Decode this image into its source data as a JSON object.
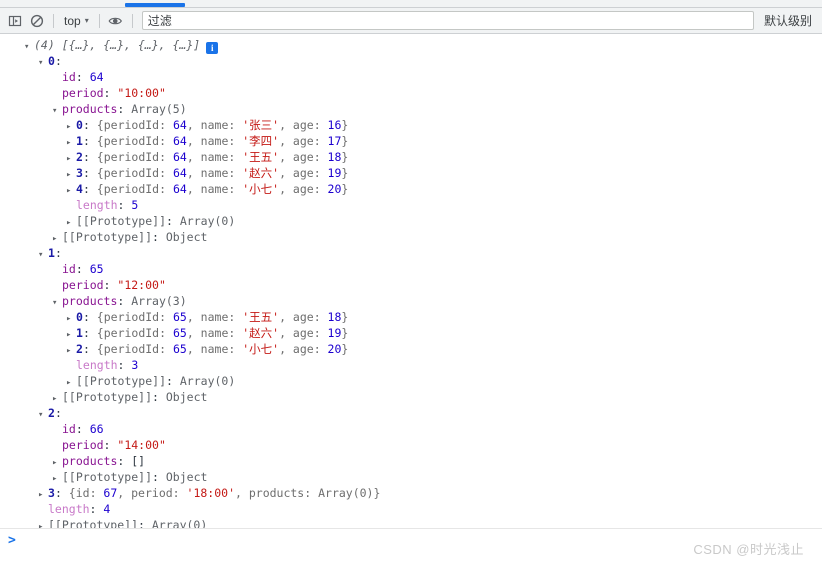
{
  "toolbar": {
    "sidebar_toggle_title": "Show console sidebar",
    "clear_title": "Clear console",
    "context_label": "top",
    "context_caret": "▾",
    "eye_title": "Create live expression",
    "filter_placeholder": "过滤",
    "filter_value": "",
    "levels_label": "默认级别",
    "accent_color": "#1a73e8"
  },
  "console": {
    "root": {
      "triangle": "▾",
      "count": "(4)",
      "preview": "[{…}, {…}, {…}, {…}]",
      "info_badge": "i"
    },
    "rows": [
      {
        "indent": 1,
        "tri": "open",
        "key": "0",
        "keytype": "index",
        "sep": ":",
        "value": "",
        "valtype": "plain"
      },
      {
        "indent": 2,
        "tri": "none",
        "key": "id",
        "keytype": "prop",
        "sep": ": ",
        "value": "64",
        "valtype": "num"
      },
      {
        "indent": 2,
        "tri": "none",
        "key": "period",
        "keytype": "prop",
        "sep": ": ",
        "value": "\"10:00\"",
        "valtype": "str"
      },
      {
        "indent": 2,
        "tri": "open",
        "key": "products",
        "keytype": "prop",
        "sep": ": ",
        "value": "Array(5)",
        "valtype": "dim"
      },
      {
        "indent": 3,
        "tri": "closed",
        "key": "0",
        "keytype": "index",
        "sep": ": ",
        "valtype": "objpreview",
        "obj": {
          "periodId": "64",
          "name": "'张三'",
          "age": "16"
        }
      },
      {
        "indent": 3,
        "tri": "closed",
        "key": "1",
        "keytype": "index",
        "sep": ": ",
        "valtype": "objpreview",
        "obj": {
          "periodId": "64",
          "name": "'李四'",
          "age": "17"
        }
      },
      {
        "indent": 3,
        "tri": "closed",
        "key": "2",
        "keytype": "index",
        "sep": ": ",
        "valtype": "objpreview",
        "obj": {
          "periodId": "64",
          "name": "'王五'",
          "age": "18"
        }
      },
      {
        "indent": 3,
        "tri": "closed",
        "key": "3",
        "keytype": "index",
        "sep": ": ",
        "valtype": "objpreview",
        "obj": {
          "periodId": "64",
          "name": "'赵六'",
          "age": "19"
        }
      },
      {
        "indent": 3,
        "tri": "closed",
        "key": "4",
        "keytype": "index",
        "sep": ": ",
        "valtype": "objpreview",
        "obj": {
          "periodId": "64",
          "name": "'小七'",
          "age": "20"
        }
      },
      {
        "indent": 3,
        "tri": "none",
        "key": "length",
        "keytype": "len",
        "sep": ": ",
        "value": "5",
        "valtype": "num"
      },
      {
        "indent": 3,
        "tri": "closed",
        "key": "[[Prototype]]",
        "keytype": "proto",
        "sep": ": ",
        "value": "Array(0)",
        "valtype": "dim"
      },
      {
        "indent": 2,
        "tri": "closed",
        "key": "[[Prototype]]",
        "keytype": "proto",
        "sep": ": ",
        "value": "Object",
        "valtype": "dim"
      },
      {
        "indent": 1,
        "tri": "open",
        "key": "1",
        "keytype": "index",
        "sep": ":",
        "value": "",
        "valtype": "plain"
      },
      {
        "indent": 2,
        "tri": "none",
        "key": "id",
        "keytype": "prop",
        "sep": ": ",
        "value": "65",
        "valtype": "num"
      },
      {
        "indent": 2,
        "tri": "none",
        "key": "period",
        "keytype": "prop",
        "sep": ": ",
        "value": "\"12:00\"",
        "valtype": "str"
      },
      {
        "indent": 2,
        "tri": "open",
        "key": "products",
        "keytype": "prop",
        "sep": ": ",
        "value": "Array(3)",
        "valtype": "dim"
      },
      {
        "indent": 3,
        "tri": "closed",
        "key": "0",
        "keytype": "index",
        "sep": ": ",
        "valtype": "objpreview",
        "obj": {
          "periodId": "65",
          "name": "'王五'",
          "age": "18"
        }
      },
      {
        "indent": 3,
        "tri": "closed",
        "key": "1",
        "keytype": "index",
        "sep": ": ",
        "valtype": "objpreview",
        "obj": {
          "periodId": "65",
          "name": "'赵六'",
          "age": "19"
        }
      },
      {
        "indent": 3,
        "tri": "closed",
        "key": "2",
        "keytype": "index",
        "sep": ": ",
        "valtype": "objpreview",
        "obj": {
          "periodId": "65",
          "name": "'小七'",
          "age": "20"
        }
      },
      {
        "indent": 3,
        "tri": "none",
        "key": "length",
        "keytype": "len",
        "sep": ": ",
        "value": "3",
        "valtype": "num"
      },
      {
        "indent": 3,
        "tri": "closed",
        "key": "[[Prototype]]",
        "keytype": "proto",
        "sep": ": ",
        "value": "Array(0)",
        "valtype": "dim"
      },
      {
        "indent": 2,
        "tri": "closed",
        "key": "[[Prototype]]",
        "keytype": "proto",
        "sep": ": ",
        "value": "Object",
        "valtype": "dim"
      },
      {
        "indent": 1,
        "tri": "open",
        "key": "2",
        "keytype": "index",
        "sep": ":",
        "value": "",
        "valtype": "plain"
      },
      {
        "indent": 2,
        "tri": "none",
        "key": "id",
        "keytype": "prop",
        "sep": ": ",
        "value": "66",
        "valtype": "num"
      },
      {
        "indent": 2,
        "tri": "none",
        "key": "period",
        "keytype": "prop",
        "sep": ": ",
        "value": "\"14:00\"",
        "valtype": "str"
      },
      {
        "indent": 2,
        "tri": "closed",
        "key": "products",
        "keytype": "prop",
        "sep": ": ",
        "value": "[]",
        "valtype": "plain"
      },
      {
        "indent": 2,
        "tri": "closed",
        "key": "[[Prototype]]",
        "keytype": "proto",
        "sep": ": ",
        "value": "Object",
        "valtype": "dim"
      },
      {
        "indent": 1,
        "tri": "closed",
        "key": "3",
        "keytype": "index",
        "sep": ": ",
        "valtype": "objpreview3",
        "obj3": {
          "id": "67",
          "period": "'18:00'",
          "products": "Array(0)"
        }
      },
      {
        "indent": 1,
        "tri": "none",
        "key": "length",
        "keytype": "len",
        "sep": ": ",
        "value": "4",
        "valtype": "num"
      },
      {
        "indent": 1,
        "tri": "closed",
        "key": "[[Prototype]]",
        "keytype": "proto",
        "sep": ": ",
        "value": "Array(0)",
        "valtype": "dim"
      }
    ]
  },
  "prompt": {
    "caret": ">",
    "value": ""
  },
  "watermark": {
    "text": "CSDN @时光浅止"
  }
}
